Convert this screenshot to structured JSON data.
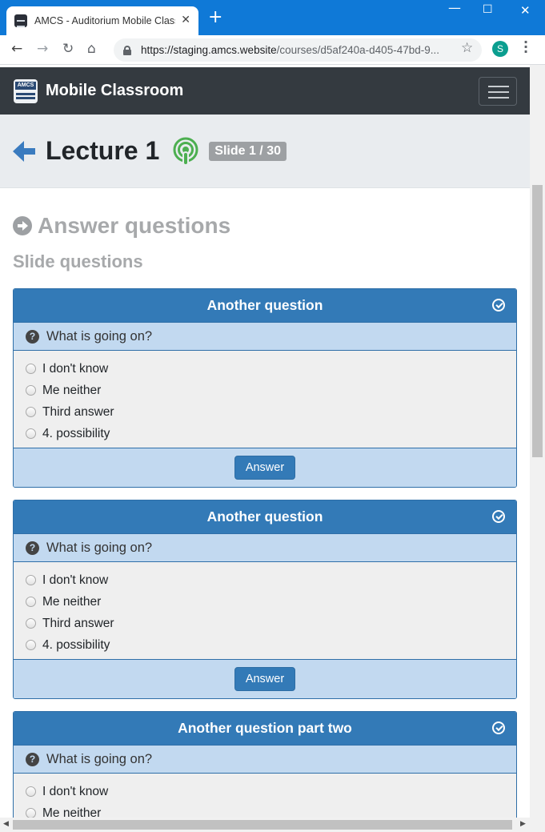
{
  "browser": {
    "tab_title": "AMCS - Auditorium Mobile Classroom",
    "url_domain": "https://staging.amcs.website",
    "url_path": "/courses/d5af240a-d405-47bd-9...",
    "profile_initial": "S"
  },
  "navbar": {
    "brand_logo_text": "AMCS",
    "brand_name": "Mobile Classroom"
  },
  "lecture": {
    "title": "Lecture 1",
    "slide_badge": "Slide 1 / 30"
  },
  "section": {
    "title": "Answer questions",
    "subtitle": "Slide questions"
  },
  "questions": [
    {
      "title": "Another question",
      "text": "What is going on?",
      "options": [
        "I don't know",
        "Me neither",
        "Third answer",
        "4. possibility"
      ],
      "button": "Answer"
    },
    {
      "title": "Another question",
      "text": "What is going on?",
      "options": [
        "I don't know",
        "Me neither",
        "Third answer",
        "4. possibility"
      ],
      "button": "Answer"
    },
    {
      "title": "Another question part two",
      "text": "What is going on?",
      "options": [
        "I don't know",
        "Me neither"
      ]
    }
  ],
  "colors": {
    "primary": "#337ab7",
    "light_primary": "#c2d9f0",
    "navbar": "#343a40",
    "podcast": "#4caf50"
  }
}
